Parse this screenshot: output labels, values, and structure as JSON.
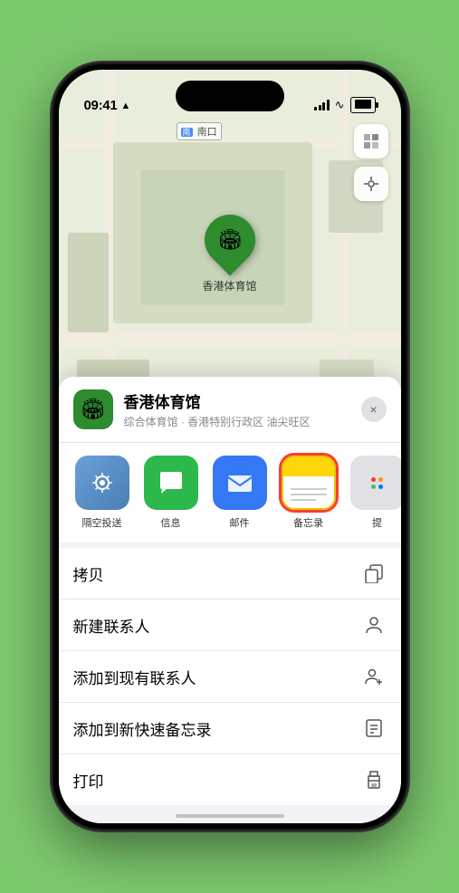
{
  "statusBar": {
    "time": "09:41",
    "location_arrow": "▶"
  },
  "map": {
    "label_nankou": "南口",
    "label_nankou_prefix": "南口",
    "pin_label": "香港体育馆"
  },
  "locationCard": {
    "name": "香港体育馆",
    "description": "综合体育馆 · 香港特别行政区 油尖旺区",
    "close_label": "×"
  },
  "shareRow": {
    "items": [
      {
        "id": "airdrop",
        "label": "隔空投送",
        "type": "airdrop"
      },
      {
        "id": "message",
        "label": "信息",
        "type": "message"
      },
      {
        "id": "mail",
        "label": "邮件",
        "type": "mail"
      },
      {
        "id": "notes",
        "label": "备忘录",
        "type": "notes",
        "selected": true
      },
      {
        "id": "more",
        "label": "提",
        "type": "more"
      }
    ]
  },
  "actionItems": [
    {
      "id": "copy",
      "label": "拷贝",
      "icon": "copy"
    },
    {
      "id": "new-contact",
      "label": "新建联系人",
      "icon": "person"
    },
    {
      "id": "add-existing",
      "label": "添加到现有联系人",
      "icon": "person-add"
    },
    {
      "id": "add-notes",
      "label": "添加到新快速备忘录",
      "icon": "note"
    },
    {
      "id": "print",
      "label": "打印",
      "icon": "printer"
    }
  ],
  "icons": {
    "copy": "⎘",
    "person": "👤",
    "person_add": "👤",
    "note": "📋",
    "printer": "🖨",
    "map": "🗺",
    "location": "➤",
    "airdrop": "📡",
    "message": "💬",
    "mail": "✉",
    "notes_char": "📝",
    "stadium": "🏟"
  }
}
